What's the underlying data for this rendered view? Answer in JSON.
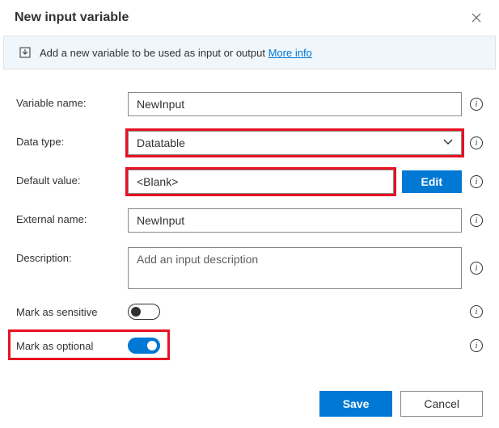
{
  "header": {
    "title": "New input variable"
  },
  "info": {
    "text": "Add a new variable to be used as input or output",
    "link": "More info"
  },
  "form": {
    "variable_name_label": "Variable name:",
    "variable_name_value": "NewInput",
    "data_type_label": "Data type:",
    "data_type_value": "Datatable",
    "default_value_label": "Default value:",
    "default_value_value": "<Blank>",
    "edit_label": "Edit",
    "external_name_label": "External name:",
    "external_name_value": "NewInput",
    "description_label": "Description:",
    "description_placeholder": "Add an input description",
    "mark_sensitive_label": "Mark as sensitive",
    "mark_optional_label": "Mark as optional"
  },
  "footer": {
    "save": "Save",
    "cancel": "Cancel"
  }
}
